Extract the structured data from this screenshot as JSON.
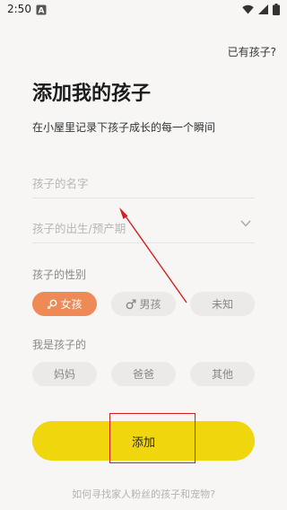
{
  "status_bar": {
    "time": "2:50"
  },
  "header": {
    "existing_child_link": "已有孩子?"
  },
  "main": {
    "title": "添加我的孩子",
    "subtitle": "在小屋里记录下孩子成长的每一个瞬间",
    "name_field": {
      "placeholder": "孩子的名字"
    },
    "birth_field": {
      "placeholder": "孩子的出生/预产期"
    },
    "gender": {
      "label": "孩子的性别",
      "options": [
        {
          "label": "女孩",
          "selected": true
        },
        {
          "label": "男孩",
          "selected": false
        },
        {
          "label": "未知",
          "selected": false
        }
      ]
    },
    "relation": {
      "label": "我是孩子的",
      "options": [
        {
          "label": "妈妈",
          "selected": false
        },
        {
          "label": "爸爸",
          "selected": false
        },
        {
          "label": "其他",
          "selected": false
        }
      ]
    },
    "add_button_label": "添加",
    "help_link": "如何寻找家人粉丝的孩子和宠物?"
  },
  "colors": {
    "accent_orange": "#ef8a57",
    "button_yellow": "#f0d60c",
    "annotation_red": "#d42020",
    "background": "#f7f6f5"
  },
  "icons": [
    "a-notification-icon",
    "wifi-icon",
    "signal-icon",
    "battery-icon",
    "female-icon",
    "male-icon",
    "chevron-down-icon",
    "red-arrow-annotation",
    "red-box-annotation"
  ]
}
